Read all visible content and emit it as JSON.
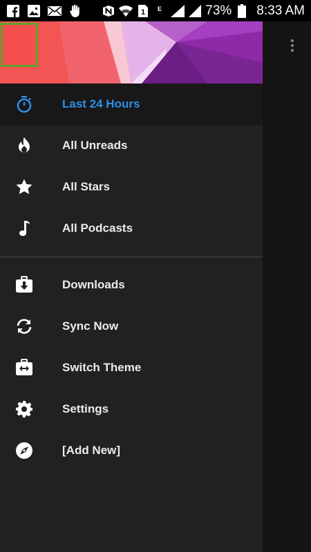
{
  "status_bar": {
    "battery_percent": "73%",
    "time": "8:33 AM",
    "icons": [
      "facebook-icon",
      "image-icon",
      "mail-icon",
      "hand-icon",
      "n-icon",
      "wifi-icon",
      "sim-icon",
      "e-icon",
      "signal-icon",
      "signal-icon",
      "battery-icon"
    ]
  },
  "header": {
    "colors": [
      "#f4504f",
      "#ffffff",
      "#d9a9e6",
      "#8e2aa8",
      "#6b1e83"
    ]
  },
  "drawer": {
    "active_color": "#2f8fe6",
    "items": [
      {
        "label": "Last 24 Hours",
        "icon": "stopwatch-icon"
      },
      {
        "label": "All Unreads",
        "icon": "flame-icon"
      },
      {
        "label": "All Stars",
        "icon": "star-icon"
      },
      {
        "label": "All Podcasts",
        "icon": "music-note-icon"
      },
      {
        "label": "Downloads",
        "icon": "download-box-icon"
      },
      {
        "label": "Sync Now",
        "icon": "sync-icon"
      },
      {
        "label": "Switch Theme",
        "icon": "switch-theme-icon"
      },
      {
        "label": "Settings",
        "icon": "gear-icon"
      },
      {
        "label": "[Add New]",
        "icon": "compass-icon"
      }
    ]
  }
}
